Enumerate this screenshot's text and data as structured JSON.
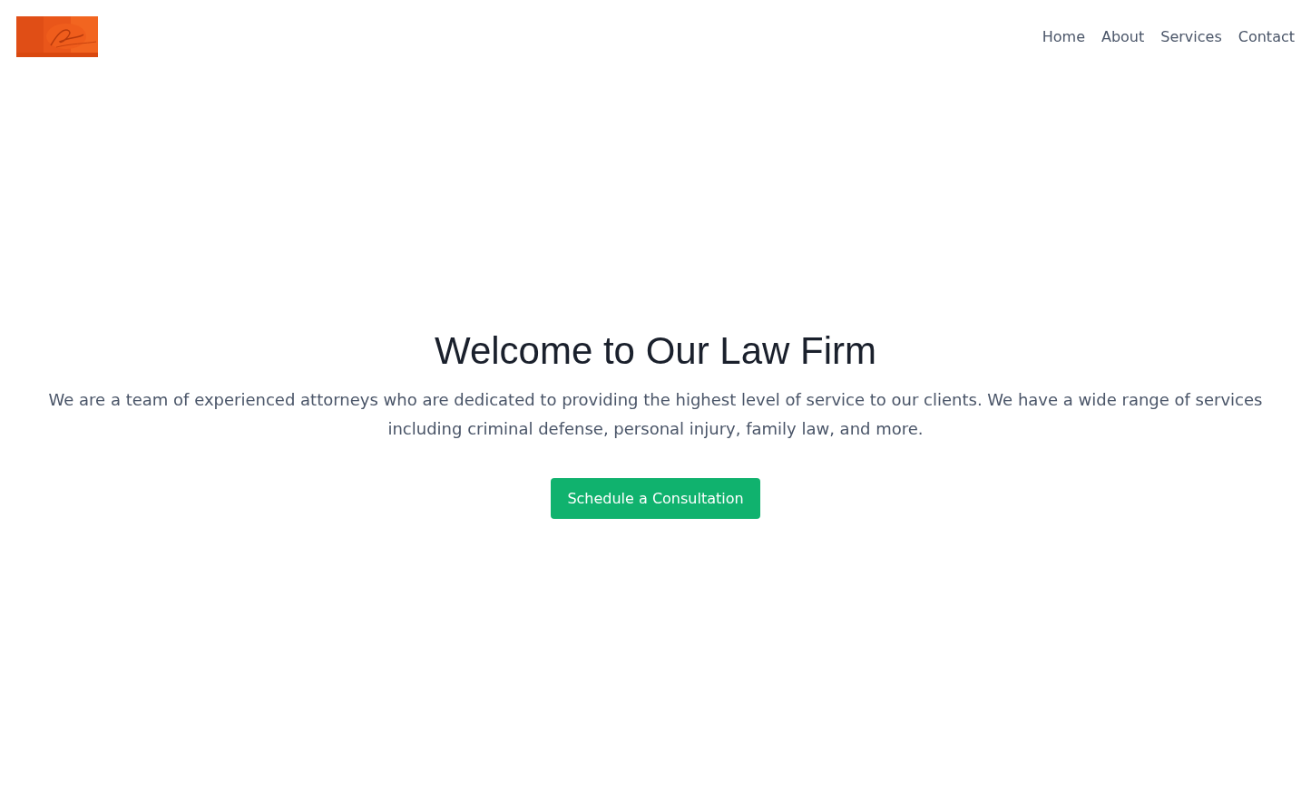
{
  "header": {
    "nav": [
      {
        "label": "Home"
      },
      {
        "label": "About"
      },
      {
        "label": "Services"
      },
      {
        "label": "Contact"
      }
    ]
  },
  "hero": {
    "title": "Welcome to Our Law Firm",
    "text": "We are a team of experienced attorneys who are dedicated to providing the highest level of service to our clients. We have a wide range of services including criminal defense, personal injury, family law, and more.",
    "button": "Schedule a Consultation"
  }
}
